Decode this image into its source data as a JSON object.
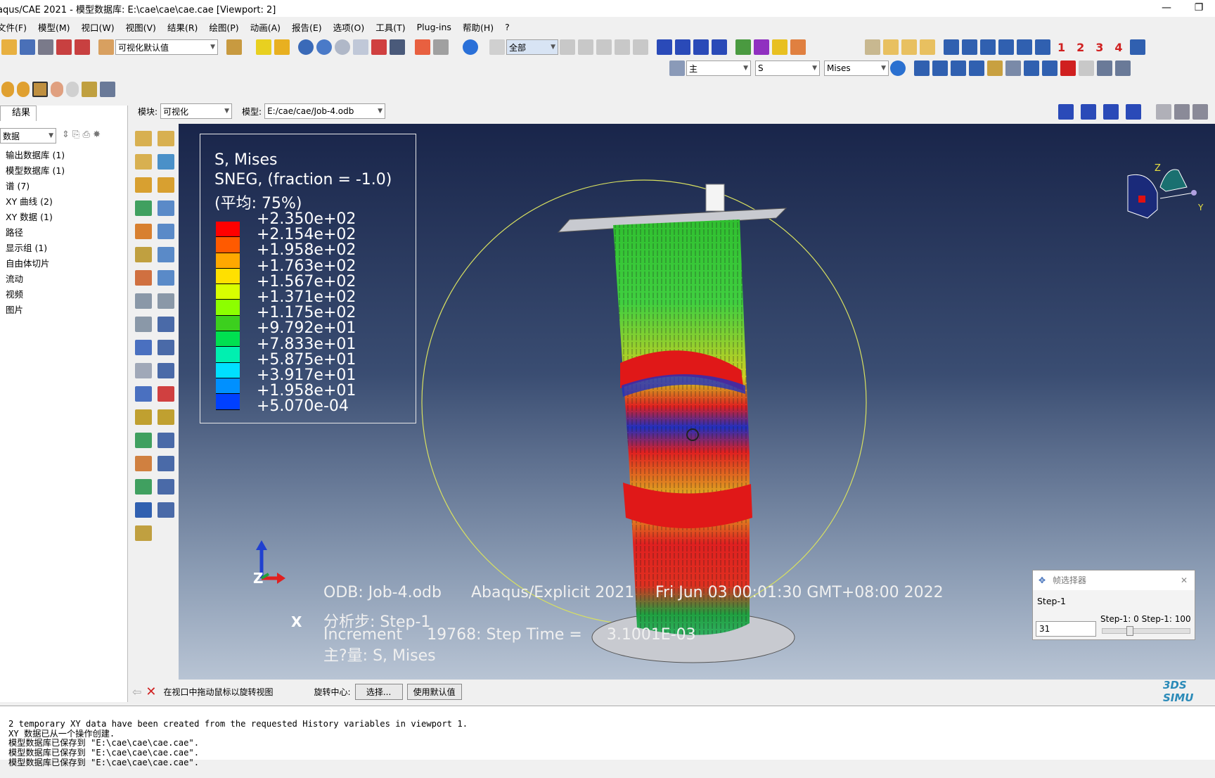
{
  "app": {
    "title": "aqus/CAE 2021 - 模型数据库: E:\\cae\\cae\\cae.cae [Viewport: 2]"
  },
  "menu": [
    "文件(F)",
    "模型(M)",
    "视口(W)",
    "视图(V)",
    "结果(R)",
    "绘图(P)",
    "动画(A)",
    "报告(E)",
    "选项(O)",
    "工具(T)",
    "Plug-ins",
    "帮助(H)",
    "?"
  ],
  "toolbar": {
    "view_default": "可视化默认值",
    "display_all": "全部",
    "primary": "主",
    "var_s": "S",
    "var_mises": "Mises",
    "step_numbers": [
      "1",
      "2",
      "3",
      "4"
    ]
  },
  "context": {
    "module_label": "模块:",
    "module_value": "可视化",
    "model_label": "模型:",
    "model_value": "E:/cae/cae/Job-4.odb"
  },
  "left": {
    "tab": "结果",
    "filter": "数据",
    "tree": [
      "输出数据库 (1)",
      "模型数据库 (1)",
      "谱 (7)",
      "XY 曲线 (2)",
      "XY 数据 (1)",
      "路径",
      "显示组 (1)",
      "自由体切片",
      "流动",
      "视频",
      "图片"
    ]
  },
  "legend": {
    "title1": "S, Mises",
    "title2": "SNEG, (fraction = -1.0)",
    "title3": "(平均: 75%)",
    "values": [
      "+2.350e+02",
      "+2.154e+02",
      "+1.958e+02",
      "+1.763e+02",
      "+1.567e+02",
      "+1.371e+02",
      "+1.175e+02",
      "+9.792e+01",
      "+7.833e+01",
      "+5.875e+01",
      "+3.917e+01",
      "+1.958e+01",
      "+5.070e-04"
    ],
    "colors": [
      "#ff0000",
      "#ff5a00",
      "#ffa800",
      "#ffe000",
      "#d8ff00",
      "#8cff00",
      "#3ccf1e",
      "#00e050",
      "#00f0b0",
      "#00e0ff",
      "#0090ff",
      "#0040ff",
      "#0000ff"
    ]
  },
  "info": {
    "odb": "ODB: Job-4.odb",
    "solver": "Abaqus/Explicit 2021",
    "date": "Fri Jun 03 00:01:30 GMT+08:00 2022",
    "step": "分析步: Step-1",
    "increment": "Increment     19768: Step Time =     3.1001E-03",
    "primary": "主?量: S, Mises"
  },
  "triad": {
    "z": "Z",
    "x": "X",
    "view_z": "Z",
    "view_y": "Y"
  },
  "frame_selector": {
    "title": "帧选择器",
    "step": "Step-1",
    "range": "Step-1: 0 Step-1: 100",
    "value": "31"
  },
  "status": {
    "prompt": "在视口中拖动鼠标以旋转视图",
    "center_label": "旋转中心:",
    "select_btn": "选择...",
    "default_btn": "使用默认值",
    "brand": "3DS SIMU"
  },
  "console": [
    "2 temporary XY data have been created from the requested History variables in viewport 1.",
    "XY 数据已从一个操作创建.",
    "模型数据库已保存到 \"E:\\cae\\cae\\cae.cae\".",
    "模型数据库已保存到 \"E:\\cae\\cae\\cae.cae\".",
    "模型数据库已保存到 \"E:\\cae\\cae\\cae.cae\"."
  ]
}
